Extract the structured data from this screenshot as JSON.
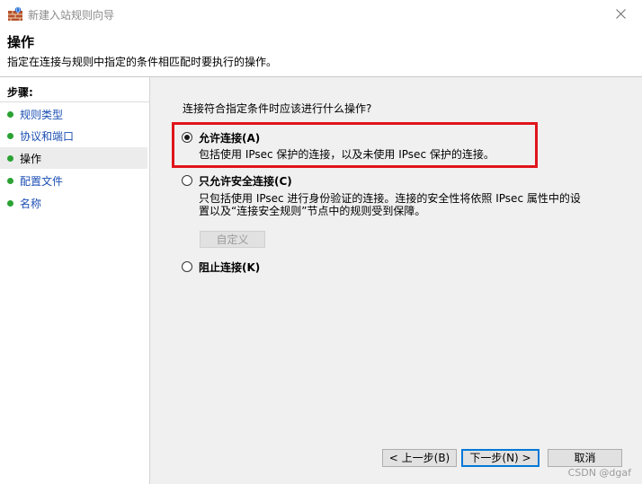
{
  "window": {
    "title": "新建入站规则向导"
  },
  "header": {
    "title": "操作",
    "subtitle": "指定在连接与规则中指定的条件相匹配时要执行的操作。"
  },
  "steps": {
    "heading": "步骤:",
    "items": [
      {
        "label": "规则类型",
        "current": false
      },
      {
        "label": "协议和端口",
        "current": false
      },
      {
        "label": "操作",
        "current": true
      },
      {
        "label": "配置文件",
        "current": false
      },
      {
        "label": "名称",
        "current": false
      }
    ]
  },
  "main": {
    "question": "连接符合指定条件时应该进行什么操作?",
    "options": [
      {
        "label": "允许连接(A)",
        "description": "包括使用 IPsec 保护的连接，以及未使用 IPsec 保护的连接。",
        "selected": true
      },
      {
        "label": "只允许安全连接(C)",
        "description_line1": "只包括使用 IPsec 进行身份验证的连接。连接的安全性将依照 IPsec 属性中的设",
        "description_line2": "置以及“连接安全规则”节点中的规则受到保障。",
        "selected": false
      },
      {
        "label": "阻止连接(K)",
        "selected": false
      }
    ],
    "customize_label": "自定义"
  },
  "footer": {
    "back_label": "< 上一步(B)",
    "next_label": "下一步(N) >",
    "cancel_label": "取消"
  },
  "watermark": "CSDN @dgaf",
  "colors": {
    "step_dot": "#2aa232",
    "step_link": "#1c4fb4",
    "highlight": "#e0141b",
    "accent": "#0078d7"
  },
  "icons": {
    "app": "firewall-wall-icon",
    "close": "close-icon",
    "step_marker": "green-dot-icon"
  }
}
